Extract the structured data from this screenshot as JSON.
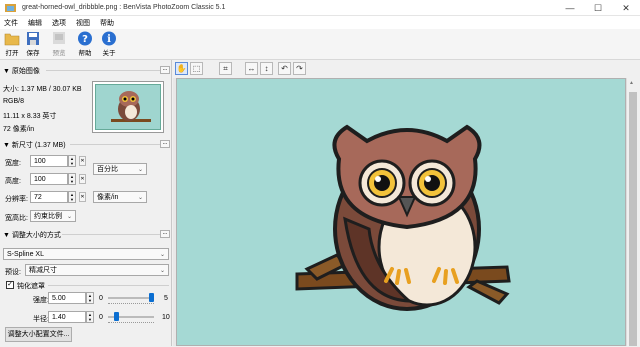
{
  "window": {
    "title": "great-horned-owl_dribbble.png : BenVista PhotoZoom Classic 5.1",
    "minimize": "—",
    "maximize": "☐",
    "close": "✕"
  },
  "menu": [
    "文件",
    "编辑",
    "选项",
    "视图",
    "帮助"
  ],
  "toolbar": {
    "open": "打开",
    "save": "保存",
    "preview": "预览",
    "help": "帮助",
    "about": "关于"
  },
  "original": {
    "heading": "原始图像",
    "size": "大小: 1.37 MB / 30.07 KB",
    "mode": "RGB/8",
    "dims": "11.11 x 8.33 英寸",
    "res": "72 像素/in"
  },
  "newsize": {
    "heading": "新尺寸 (1.37 MB)",
    "width_label": "宽度:",
    "width_value": "100",
    "height_label": "高度:",
    "height_value": "100",
    "res_label": "分辨率:",
    "res_value": "72",
    "unit_percent": "百分比",
    "unit_res": "像素/in",
    "aspect_label": "宽高比:",
    "aspect_value": "约束比例"
  },
  "method": {
    "heading": "调整大小的方式",
    "algorithm": "S-Spline XL",
    "preset_label": "预设:",
    "preset_value": "精减尺寸",
    "sharpen_label": "钝化遮罩",
    "strength_label": "强度:",
    "strength_value": "5.00",
    "strength_min": "0",
    "strength_max": "5",
    "strength_level": 1.0,
    "radius_label": "半径:",
    "radius_value": "1.40",
    "radius_min": "0",
    "radius_max": "10",
    "radius_level": 0.14,
    "config_button": "调整大小配置文件..."
  },
  "more_btn": "...",
  "colors": {
    "canvas_bg": "#a5d9d4",
    "accent": "#0a6ed1"
  }
}
